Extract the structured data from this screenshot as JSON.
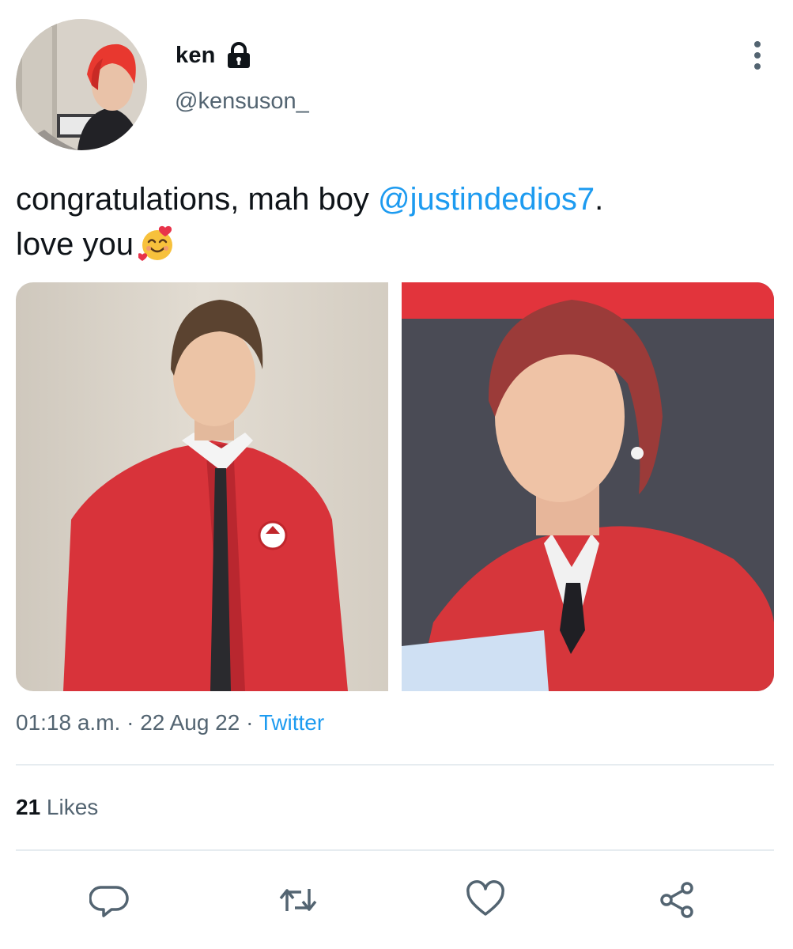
{
  "author": {
    "display_name": "ken",
    "handle": "@kensuson_",
    "protected_icon": "lock-icon",
    "avatar_icon": "profile-photo",
    "hair_color": "#e8382f"
  },
  "tweet": {
    "text_lead": "congratulations, mah boy ",
    "mention": "@justindedios7",
    "text_after_mention": ".",
    "line2": "love you",
    "emoji": "smiling-face-with-hearts-icon"
  },
  "media": [
    {
      "name": "photo-1",
      "description_icon": "jacket-portrait-photo"
    },
    {
      "name": "photo-2",
      "description_icon": "jacket-closeup-photo"
    }
  ],
  "meta": {
    "time": "01:18 a.m.",
    "sep1": " · ",
    "date": "22 Aug 22",
    "sep2": " · ",
    "source": "Twitter"
  },
  "stats": {
    "likes_count": "21",
    "likes_label": " Likes"
  },
  "actions": [
    {
      "name": "reply",
      "icon": "reply-icon"
    },
    {
      "name": "retweet",
      "icon": "retweet-icon"
    },
    {
      "name": "like",
      "icon": "heart-icon"
    },
    {
      "name": "share",
      "icon": "share-icon"
    }
  ],
  "colors": {
    "accent": "#1d9bf0",
    "secondary_text": "#536471",
    "primary_text": "#0f1419",
    "divider": "#e6ecf0",
    "jacket_red": "#e2373a"
  }
}
